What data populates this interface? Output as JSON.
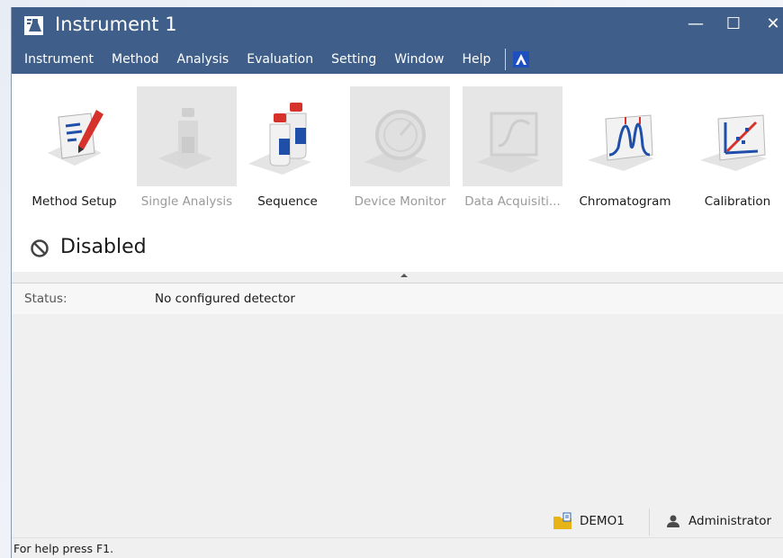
{
  "window": {
    "title": "Instrument 1",
    "controls": {
      "minimize": "—",
      "maximize": "☐",
      "close": "✕"
    }
  },
  "menu": {
    "items": [
      {
        "label": "Instrument"
      },
      {
        "label": "Method"
      },
      {
        "label": "Analysis"
      },
      {
        "label": "Evaluation"
      },
      {
        "label": "Setting"
      },
      {
        "label": "Window"
      },
      {
        "label": "Help"
      }
    ]
  },
  "toolbar": {
    "items": [
      {
        "label": "Method Setup",
        "icon": "method-setup-icon",
        "enabled": true
      },
      {
        "label": "Single Analysis",
        "icon": "bottle-icon",
        "enabled": false
      },
      {
        "label": "Sequence",
        "icon": "bottles-icon",
        "enabled": true
      },
      {
        "label": "Device Monitor",
        "icon": "gauge-icon",
        "enabled": false
      },
      {
        "label": "Data Acquisiti...",
        "icon": "monitor-icon",
        "enabled": false
      },
      {
        "label": "Chromatogram",
        "icon": "chromatogram-icon",
        "enabled": true
      },
      {
        "label": "Calibration",
        "icon": "calibration-icon",
        "enabled": true
      }
    ]
  },
  "state": {
    "text": "Disabled",
    "icon": "prohibited-icon"
  },
  "status": {
    "label": "Status:",
    "value": "No configured detector"
  },
  "footer": {
    "project": "DEMO1",
    "user": "Administrator",
    "help": "For help press F1."
  },
  "colors": {
    "titlebar": "#3f5f8a",
    "accent_blue": "#1f4fa8",
    "accent_red": "#d6312b",
    "folder_yellow": "#e6b416"
  }
}
